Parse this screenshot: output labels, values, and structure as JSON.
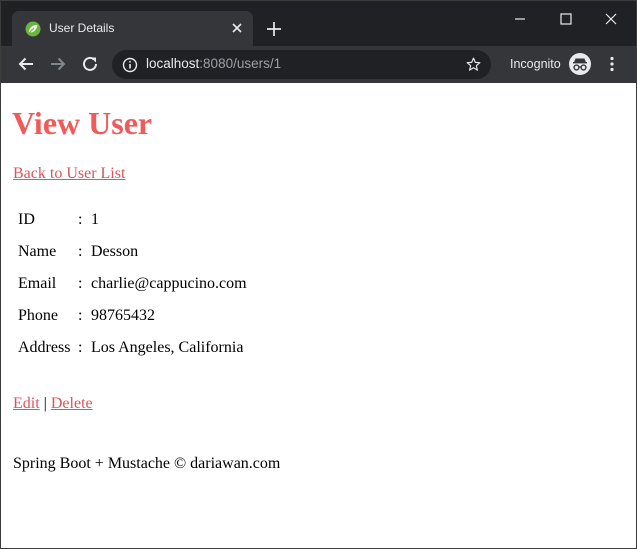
{
  "browser": {
    "tab_title": "User Details",
    "url_host": "localhost",
    "url_rest": ":8080/users/1",
    "incognito_label": "Incognito",
    "icons": [
      "spring-leaf-icon",
      "close-icon",
      "plus-icon",
      "minimize-icon",
      "maximize-icon",
      "close-icon",
      "back-arrow-icon",
      "forward-arrow-icon",
      "reload-icon",
      "info-icon",
      "star-icon",
      "incognito-icon",
      "more-vert-icon"
    ]
  },
  "page": {
    "title": "View User",
    "back_link": "Back to User List",
    "details": [
      {
        "label": "ID",
        "sep": ":",
        "value": "1"
      },
      {
        "label": "Name",
        "sep": ":",
        "value": "Desson"
      },
      {
        "label": "Email",
        "sep": ":",
        "value": "charlie@cappucino.com"
      },
      {
        "label": "Phone",
        "sep": ":",
        "value": "98765432"
      },
      {
        "label": "Address",
        "sep": ":",
        "value": "Los Angeles, California"
      }
    ],
    "edit_link": "Edit",
    "action_separator": " | ",
    "delete_link": "Delete",
    "footer": "Spring Boot + Mustache © dariawan.com"
  },
  "colors": {
    "title": "#f05a5a",
    "link": "#e05257",
    "titlebar": "#202124",
    "toolbar": "#35363a"
  }
}
